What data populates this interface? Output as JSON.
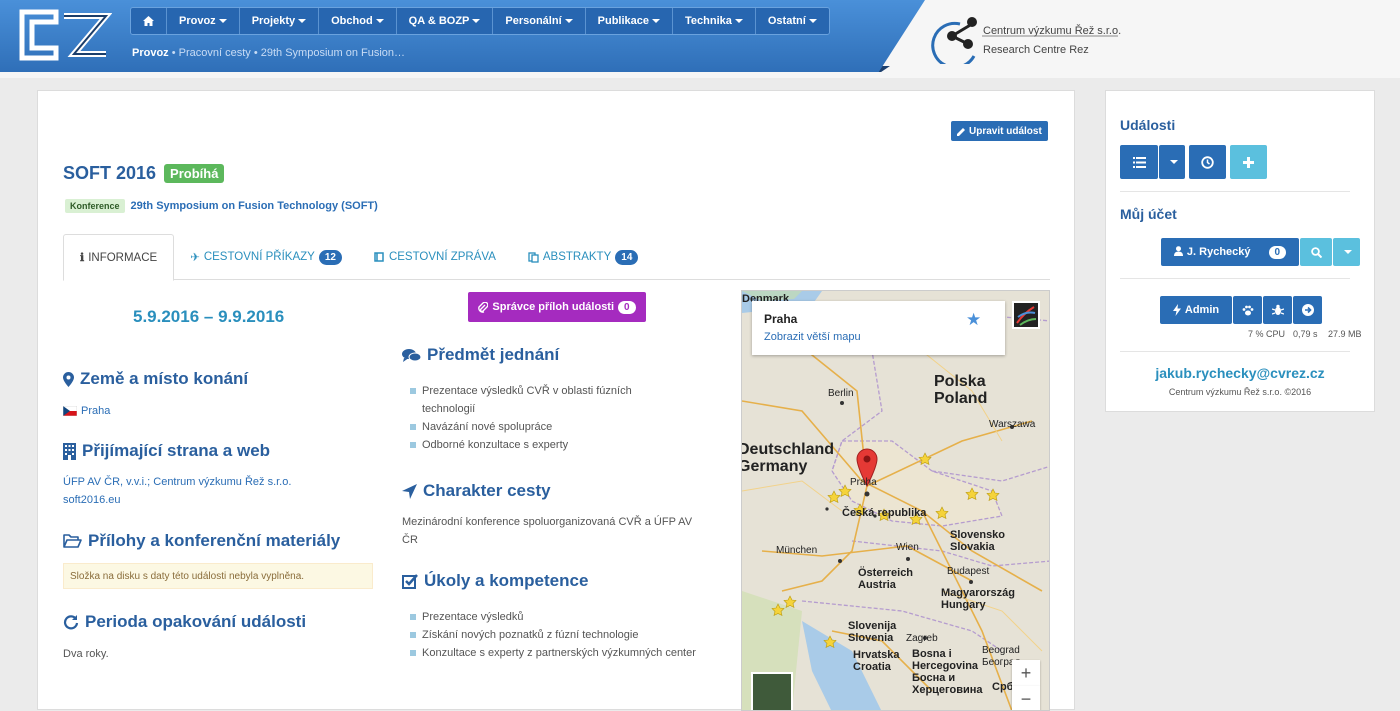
{
  "header": {
    "nav": [
      {
        "label": "",
        "icon": "home-icon"
      },
      {
        "label": "Provoz"
      },
      {
        "label": "Projekty"
      },
      {
        "label": "Obchod"
      },
      {
        "label": "QA & BOZP"
      },
      {
        "label": "Personální"
      },
      {
        "label": "Publikace"
      },
      {
        "label": "Technika"
      },
      {
        "label": "Ostatní"
      }
    ],
    "breadcrumb": {
      "root": "Provoz",
      "trail": " • Pracovní cesty • 29th Symposium on Fusion…"
    },
    "org_name_line1": "Centrum výzkumu Řež s.r.o.",
    "org_name_line2": "Research Centre Rez"
  },
  "event": {
    "edit_label": "Upravit událost",
    "title": "SOFT 2016",
    "status": "Probíhá",
    "type_badge": "Konference",
    "full_name": "29th Symposium on Fusion Technology (SOFT)",
    "date_range": "5.9.2016 – 9.9.2016"
  },
  "tabs": [
    {
      "label": "INFORMACE",
      "count": null
    },
    {
      "label": "CESTOVNÍ PŘÍKAZY",
      "count": "12"
    },
    {
      "label": "CESTOVNÍ ZPRÁVA",
      "count": null
    },
    {
      "label": "ABSTRAKTY",
      "count": "14"
    }
  ],
  "sections": {
    "place": {
      "title": "Země a místo konání",
      "city": "Praha"
    },
    "host": {
      "title": "Přijímající strana a web",
      "parties": "ÚFP AV ČR, v.v.i.; Centrum výzkumu Řež s.r.o.",
      "web": "soft2016.eu"
    },
    "attachments": {
      "title": "Přílohy a konferenční materiály",
      "note": "Složka na disku s daty této události nebyla vyplněna."
    },
    "period": {
      "title": "Perioda opakování události",
      "text": "Dva roky."
    },
    "subject": {
      "title": "Předmět jednání",
      "items": [
        "Prezentace výsledků CVŘ v oblasti fúzních technologií",
        "Navázání nové spolupráce",
        "Odborné konzultace s experty"
      ]
    },
    "character": {
      "title": "Charakter cesty",
      "text": "Mezinárodní konference spoluorganizovaná CVŘ a ÚFP AV ČR"
    },
    "tasks": {
      "title": "Úkoly a kompetence",
      "items": [
        "Prezentace výsledků",
        "Získání nových poznatků z fúzní technologie",
        "Konzultace s experty z partnerských výzkumných center"
      ]
    }
  },
  "attachments_manager": {
    "label": "Správce příloh události",
    "count": "0"
  },
  "map": {
    "card_title": "Praha",
    "card_link": "Zobrazit větší mapu",
    "labels": {
      "denmark": "Denmark",
      "berlin": "Berlin",
      "poland1": "Polska",
      "poland2": "Poland",
      "warszawa": "Warszawa",
      "germany1": "Deutschland",
      "germany2": "Germany",
      "praha": "Praha",
      "czech": "Česká republika",
      "slovakia1": "Slovensko",
      "slovakia2": "Slovakia",
      "munchen": "München",
      "wien": "Wien",
      "budapest": "Budapest",
      "austria1": "Österreich",
      "austria2": "Austria",
      "hungary1": "Magyarország",
      "hungary2": "Hungary",
      "slovenia1": "Slovenija",
      "slovenia2": "Slovenia",
      "zagreb": "Zagreb",
      "croatia1": "Hrvatska",
      "croatia2": "Croatia",
      "bih1": "Bosna i",
      "bih2": "Hercegovina",
      "bih3": "Босна и",
      "bih4": "Херцеговина",
      "beograd1": "Beograd",
      "beograd2": "Београд",
      "srbija": "Срб"
    },
    "zoom_in": "+",
    "zoom_out": "−"
  },
  "sidebar": {
    "events_title": "Události",
    "account_title": "Můj účet",
    "user_name": "J. Rychecký",
    "user_count": "0",
    "admin_label": "Admin",
    "stats": {
      "cpu": "7 % CPU",
      "time": "0,79 s",
      "mem": "27.9 MB"
    },
    "email": "jakub.rychecky@cvrez.cz",
    "copyright": "Centrum výzkumu Řež s.r.o. ©2016"
  },
  "colors": {
    "primary": "#2a6db5",
    "accent": "#2a8fbd",
    "success": "#5cb85c",
    "purple": "#a52bbf",
    "info": "#5bc0de"
  }
}
